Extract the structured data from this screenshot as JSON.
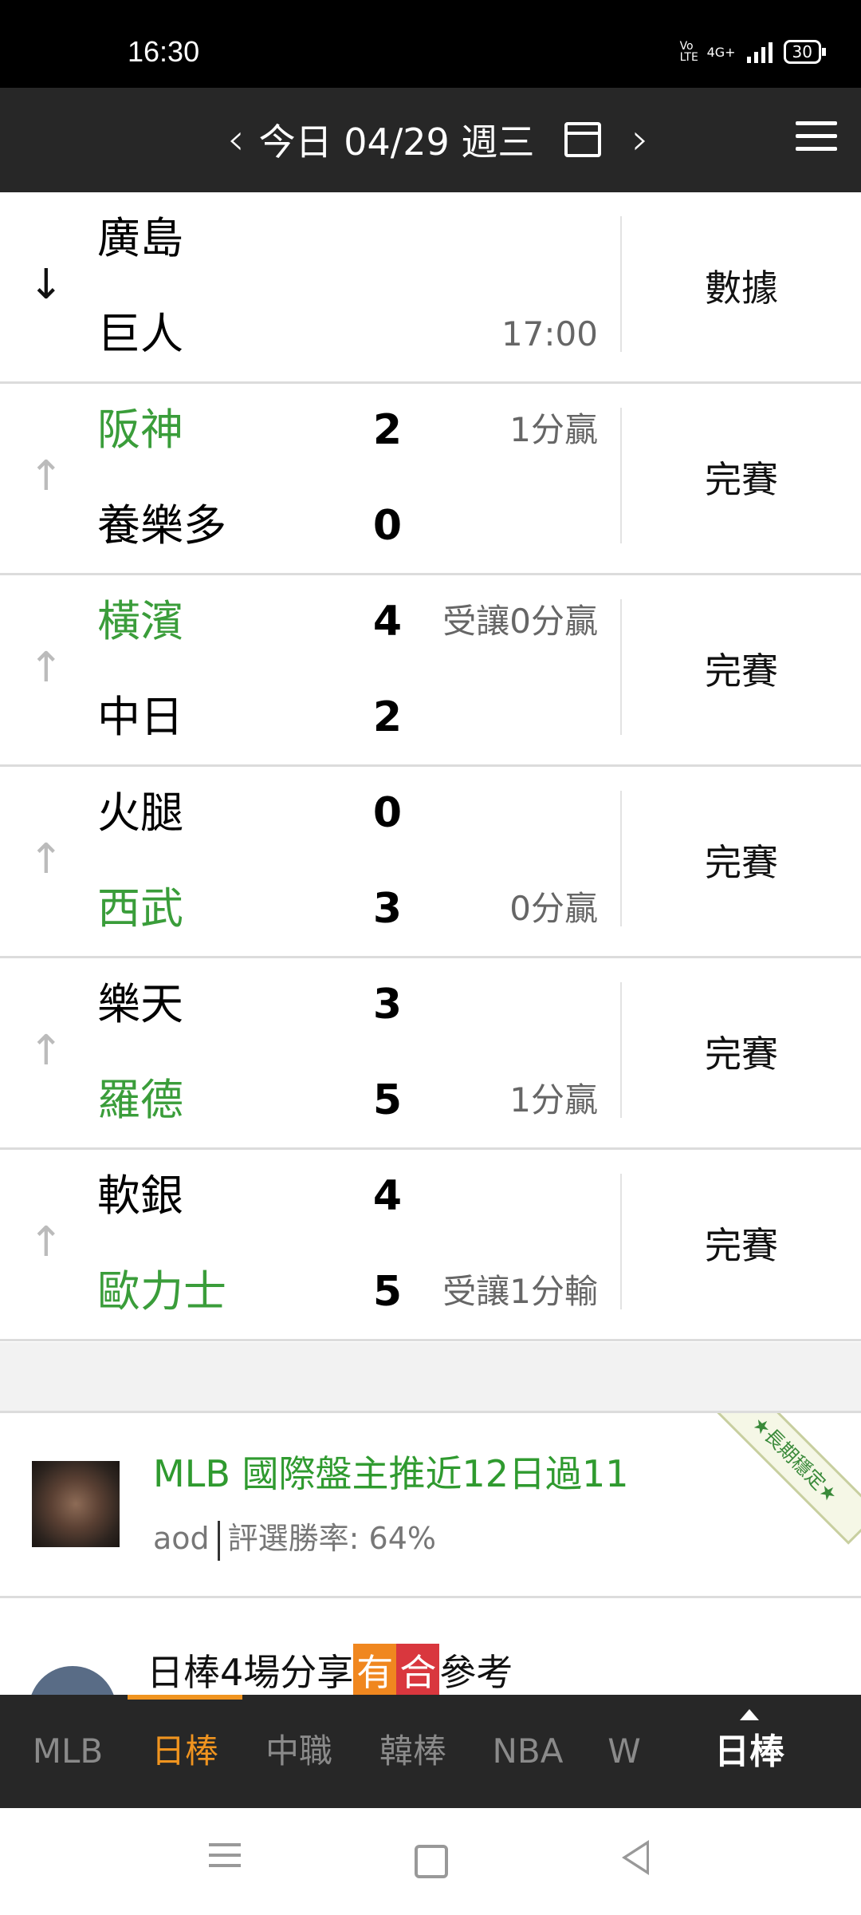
{
  "status_bar": {
    "time": "16:30",
    "network": "4G+",
    "volte": "Vo LTE",
    "battery": "30"
  },
  "header": {
    "prev_icon": "chevron-left-icon",
    "date_label": "今日 04/29 週三",
    "calendar_icon": "calendar-icon",
    "next_icon": "chevron-right-icon",
    "menu_icon": "hamburger-menu-icon"
  },
  "games": [
    {
      "arrow": "↓",
      "arrow_color": "#111111",
      "team1": "廣島",
      "team1_win": false,
      "score1": "",
      "note1": "",
      "team2": "巨人",
      "team2_win": false,
      "score2": "",
      "note2": "17:00",
      "status": "數據"
    },
    {
      "arrow": "↑",
      "arrow_color": "#bbbbbb",
      "team1": "阪神",
      "team1_win": true,
      "score1": "2",
      "note1": "1分贏",
      "team2": "養樂多",
      "team2_win": false,
      "score2": "0",
      "note2": "",
      "status": "完賽"
    },
    {
      "arrow": "↑",
      "arrow_color": "#bbbbbb",
      "team1": "橫濱",
      "team1_win": true,
      "score1": "4",
      "note1": "受讓0分贏",
      "team2": "中日",
      "team2_win": false,
      "score2": "2",
      "note2": "",
      "status": "完賽"
    },
    {
      "arrow": "↑",
      "arrow_color": "#bbbbbb",
      "team1": "火腿",
      "team1_win": false,
      "score1": "0",
      "note1": "",
      "team2": "西武",
      "team2_win": true,
      "score2": "3",
      "note2": "0分贏",
      "status": "完賽"
    },
    {
      "arrow": "↑",
      "arrow_color": "#bbbbbb",
      "team1": "樂天",
      "team1_win": false,
      "score1": "3",
      "note1": "",
      "team2": "羅德",
      "team2_win": true,
      "score2": "5",
      "note2": "1分贏",
      "status": "完賽"
    },
    {
      "arrow": "↑",
      "arrow_color": "#bbbbbb",
      "team1": "軟銀",
      "team1_win": false,
      "score1": "4",
      "note1": "",
      "team2": "歐力士",
      "team2_win": true,
      "score2": "5",
      "note2": "受讓1分輸",
      "status": "完賽"
    }
  ],
  "posts": [
    {
      "title": "MLB 國際盤主推近12日過11",
      "author": "aod",
      "win_rate": "評選勝率: 64%",
      "ribbon": "★長期穩定★"
    },
    {
      "title_prefix": "日棒4場分享",
      "badge1": "有",
      "badge2": "合",
      "title_suffix": "參考"
    }
  ],
  "tabs": [
    {
      "label": "MLB",
      "active": false
    },
    {
      "label": "日棒",
      "active": true
    },
    {
      "label": "中職",
      "active": false
    },
    {
      "label": "韓棒",
      "active": false
    },
    {
      "label": "NBA",
      "active": false
    },
    {
      "label": "W",
      "active": false
    }
  ],
  "current_league": "日棒",
  "colors": {
    "win_green": "#3a9d3a",
    "accent_orange": "#f0941f",
    "header_bg": "#272727"
  }
}
